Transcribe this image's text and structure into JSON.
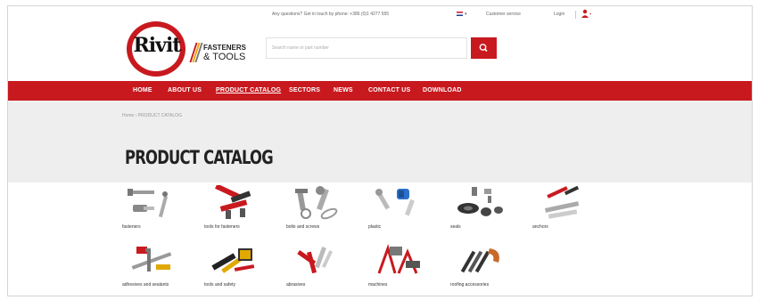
{
  "topbar": {
    "help_text": "Any questions? Get in touch by phone: +386 (0)1 4277 555",
    "language": "▾",
    "customer_service": "Customer service",
    "login": "Login"
  },
  "logo": {
    "word": "Rivit",
    "line1": "FASTENERS",
    "line2": "& TOOLS"
  },
  "search": {
    "placeholder": "Search name or part number"
  },
  "nav": {
    "items": [
      "HOME",
      "ABOUT US",
      "PRODUCT CATALOG",
      "SECTORS",
      "NEWS",
      "CONTACT US",
      "DOWNLOAD"
    ]
  },
  "breadcrumb": "Home › PRODUCT CATALOG",
  "page_title": "PRODUCT CATALOG",
  "categories": [
    {
      "label": "fasteners",
      "icon": "rivets-icon"
    },
    {
      "label": "tools for fasteners",
      "icon": "riveting-tool-icon"
    },
    {
      "label": "bolts and screws",
      "icon": "screws-icon"
    },
    {
      "label": "plastic",
      "icon": "plastic-fastener-icon"
    },
    {
      "label": "seals",
      "icon": "seals-icon"
    },
    {
      "label": "anchors",
      "icon": "anchors-icon"
    },
    {
      "label": "adhesives and sealants",
      "icon": "sealant-gun-icon"
    },
    {
      "label": "tools and safety",
      "icon": "hand-tools-icon"
    },
    {
      "label": "abrasives",
      "icon": "abrasives-icon"
    },
    {
      "label": "machines",
      "icon": "machine-icon"
    },
    {
      "label": "roofing accessories",
      "icon": "roofing-icon"
    }
  ],
  "colors": {
    "brand_red": "#c8191f",
    "background_grey": "#eeeeee"
  }
}
